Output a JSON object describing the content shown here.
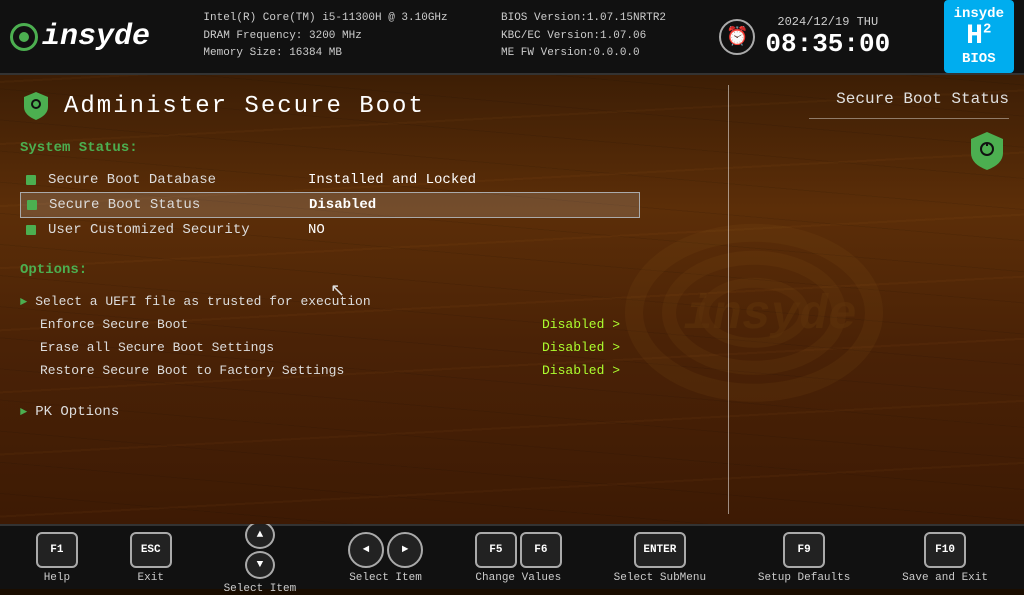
{
  "header": {
    "logo": "insyde",
    "cpu": "Intel(R) Core(TM) i5-11300H @ 3.10GHz",
    "dram": "DRAM Frequency: 3200 MHz",
    "memory": "Memory Size: 16384 MB",
    "bios": "BIOS Version:1.07.15NRTR2",
    "kbc": "KBC/EC Version:1.07.06",
    "me": "ME FW Version:0.0.0.0",
    "date": "2024/12/19",
    "day": "THU",
    "time": "08:35:00",
    "badge_h": "H",
    "badge_2": "2",
    "badge_bios": "BIOS"
  },
  "page": {
    "title": "Administer Secure Boot",
    "system_status_label": "System Status:"
  },
  "status_items": [
    {
      "label": "Secure Boot Database",
      "value": "Installed and Locked",
      "selected": false
    },
    {
      "label": "Secure Boot Status",
      "value": "Disabled",
      "selected": true
    },
    {
      "label": "User Customized Security",
      "value": "NO",
      "selected": false
    }
  ],
  "options": {
    "label": "Options:",
    "items": [
      {
        "label": "Select a UEFI file as trusted for execution",
        "value": "",
        "has_arrow": true,
        "is_arrow": true
      },
      {
        "label": "Enforce Secure Boot",
        "value": "Disabled >",
        "has_arrow": false
      },
      {
        "label": "Erase all Secure Boot Settings",
        "value": "Disabled >",
        "has_arrow": false
      },
      {
        "label": "Restore Secure Boot to Factory Settings",
        "value": "Disabled >",
        "has_arrow": false
      }
    ]
  },
  "pk_options": {
    "label": "PK Options",
    "has_arrow": true
  },
  "right_panel": {
    "title": "Secure Boot Status"
  },
  "footer": {
    "keys": [
      {
        "id": "f1",
        "buttons": [
          "F1"
        ],
        "label": "Help"
      },
      {
        "id": "esc",
        "buttons": [
          "ESC"
        ],
        "label": "Exit"
      },
      {
        "id": "select_item_arrows",
        "buttons": [
          "↑",
          "↓"
        ],
        "label": "Select Item"
      },
      {
        "id": "select_item_lr",
        "buttons": [
          "←",
          "→"
        ],
        "label": "Select Item"
      },
      {
        "id": "f5f6",
        "buttons": [
          "F5",
          "F6"
        ],
        "label": "Change Values"
      },
      {
        "id": "enter",
        "buttons": [
          "ENTER"
        ],
        "label": "Select  SubMenu"
      },
      {
        "id": "f9",
        "buttons": [
          "F9"
        ],
        "label": "Setup Defaults"
      },
      {
        "id": "f10",
        "buttons": [
          "F10"
        ],
        "label": "Save and Exit"
      }
    ]
  }
}
